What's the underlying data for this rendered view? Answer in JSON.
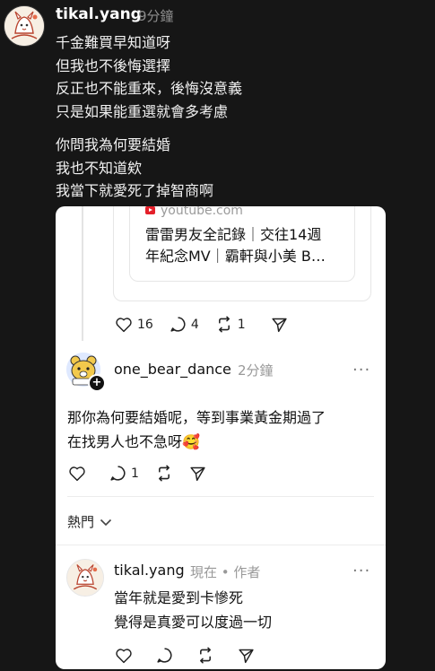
{
  "top_post": {
    "username": "tikal.yang",
    "time": "9分鐘",
    "lines": [
      "千金難買早知道呀",
      "但我也不後悔選擇",
      "反正也不能重來，後悔沒意義",
      "只是如果能重選就會多考慮"
    ],
    "lines2": [
      "你問我為何要結婚",
      "我也不知道欸",
      "我當下就愛死了掉智商啊"
    ]
  },
  "embed": {
    "link": {
      "domain": "youtube.com",
      "title_line1": "雷雷男友全記錄｜交往14週",
      "title_line2": "年紀念MV｜霸軒與小美 B…"
    },
    "quoted_actions": {
      "likes": "16",
      "comments": "4",
      "reposts": "1"
    },
    "comment": {
      "username": "one_bear_dance",
      "time": "2分鐘",
      "more": "···",
      "text_line1": "那你為何要結婚呢，等到事業黃金期過了",
      "text_line2": "在找男人也不急呀🥰",
      "comments": "1"
    },
    "sort_label": "熱門",
    "reply": {
      "username": "tikal.yang",
      "meta": "現在 • 作者",
      "more": "···",
      "text_line1": "當年就是愛到卡慘死",
      "text_line2": "覺得是真愛可以度過一切"
    }
  },
  "colors": {
    "background": "#161616",
    "card": "#ffffff",
    "youtube_red": "#e4202a"
  }
}
